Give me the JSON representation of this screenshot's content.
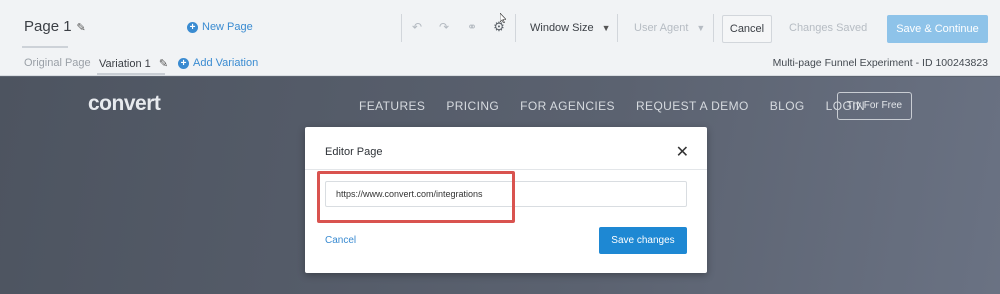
{
  "toolbar": {
    "page_title": "Page 1",
    "new_page": "New Page",
    "window_size": "Window Size",
    "user_agent": "User Agent",
    "cancel": "Cancel",
    "changes_saved": "Changes Saved",
    "save_continue": "Save & Continue"
  },
  "subbar": {
    "original_page": "Original Page",
    "variation": "Variation 1",
    "add_variation": "Add Variation",
    "experiment_info": "Multi-page Funnel Experiment - ID 100243823"
  },
  "site": {
    "logo": "convert",
    "nav": [
      "FEATURES",
      "PRICING",
      "FOR AGENCIES",
      "REQUEST A DEMO",
      "BLOG",
      "LOGIN"
    ],
    "cta": "Try For Free"
  },
  "modal": {
    "title": "Editor Page",
    "url_value": "https://www.convert.com/integrations",
    "cancel": "Cancel",
    "save": "Save changes"
  },
  "icons": {
    "undo": "undo-icon",
    "redo": "redo-icon",
    "link": "link-icon",
    "settings": "gear-icon",
    "close": "close-icon"
  },
  "colors": {
    "accent": "#1e88d3",
    "highlight": "#d9534f"
  }
}
